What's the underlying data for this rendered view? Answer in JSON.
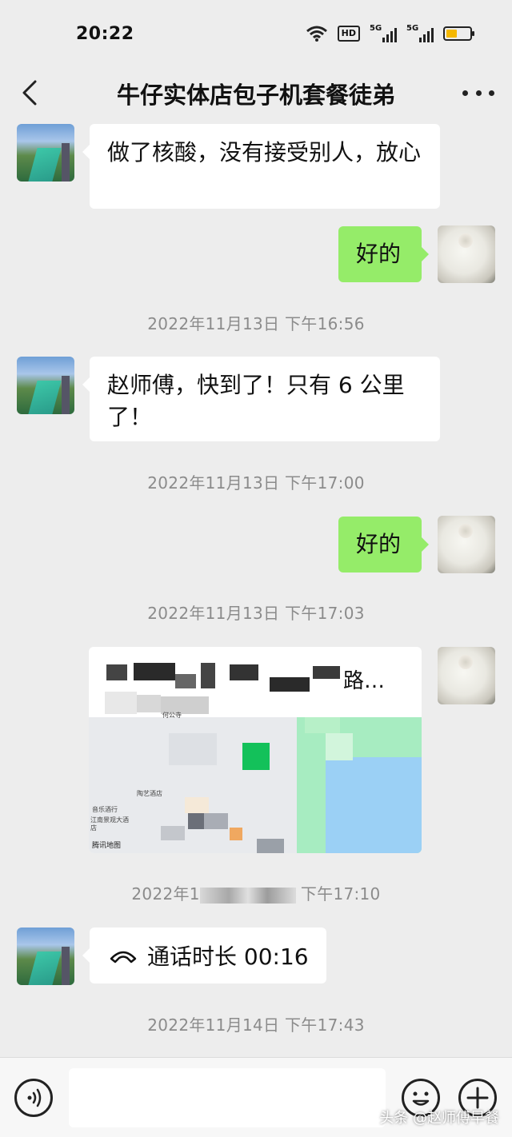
{
  "status_bar": {
    "time": "20:22",
    "hd": "HD",
    "signal_1": "5G",
    "signal_2": "5G",
    "battery_color": "#f5b800"
  },
  "header": {
    "title": "牛仔实体店包子机套餐徒弟"
  },
  "messages": [
    {
      "from": "partner",
      "text": "做了核酸，没有接受别人，放心"
    },
    {
      "from": "me",
      "text": "好的"
    },
    {
      "timestamp": "2022年11月13日 下午16:56"
    },
    {
      "from": "partner",
      "text": "赵师傅，快到了！只有 6 公里了！"
    },
    {
      "timestamp": "2022年11月13日 下午17:00"
    },
    {
      "from": "me",
      "text": "好的"
    },
    {
      "timestamp": "2022年11月13日 下午17:03"
    },
    {
      "from": "me",
      "type": "location",
      "title": "路…",
      "poi_1": "陶艺酒店",
      "poi_2": "音乐酒行",
      "poi_3": "江南景观大酒店",
      "poi_4": "何公寺",
      "map_credit": "腾讯地图"
    },
    {
      "timestamp": "2022年1",
      "timestamp_tail": "下午17:10"
    },
    {
      "from": "partner",
      "type": "call",
      "text": "通话时长 00:16"
    },
    {
      "timestamp": "2022年11月14日 下午17:43"
    }
  ],
  "input_bar": {
    "watermark": "头条 @赵师傅早餐"
  },
  "colors": {
    "background": "#ededed",
    "my_bubble": "#95ec69",
    "partner_bubble": "#ffffff",
    "timestamp": "#8b8b8b"
  }
}
